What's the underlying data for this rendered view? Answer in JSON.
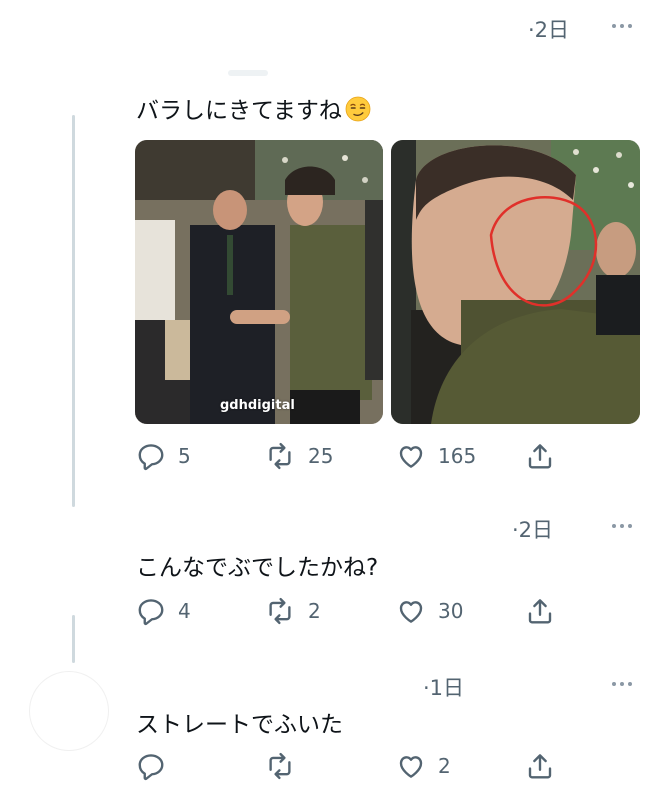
{
  "colors": {
    "text": "#0f1419",
    "muted": "#536471",
    "thread": "#cfd9de",
    "circle": "#e0302a"
  },
  "reply1": {
    "time": "·2日",
    "text": "バラしにきてますね",
    "emoji": "smirking-face-emoji",
    "watermark": "gdhdigital",
    "actions": {
      "replies": "5",
      "retweets": "25",
      "likes": "165"
    }
  },
  "reply2": {
    "time": "·2日",
    "text": "こんなでぶでしたかね?",
    "actions": {
      "replies": "4",
      "retweets": "2",
      "likes": "30"
    }
  },
  "reply3": {
    "time": "·1日",
    "text": "ストレートでふいた",
    "actions": {
      "replies": "",
      "retweets": "",
      "likes": "2"
    }
  },
  "icons": [
    "reply-icon",
    "retweet-icon",
    "like-icon",
    "share-icon",
    "more-icon"
  ]
}
